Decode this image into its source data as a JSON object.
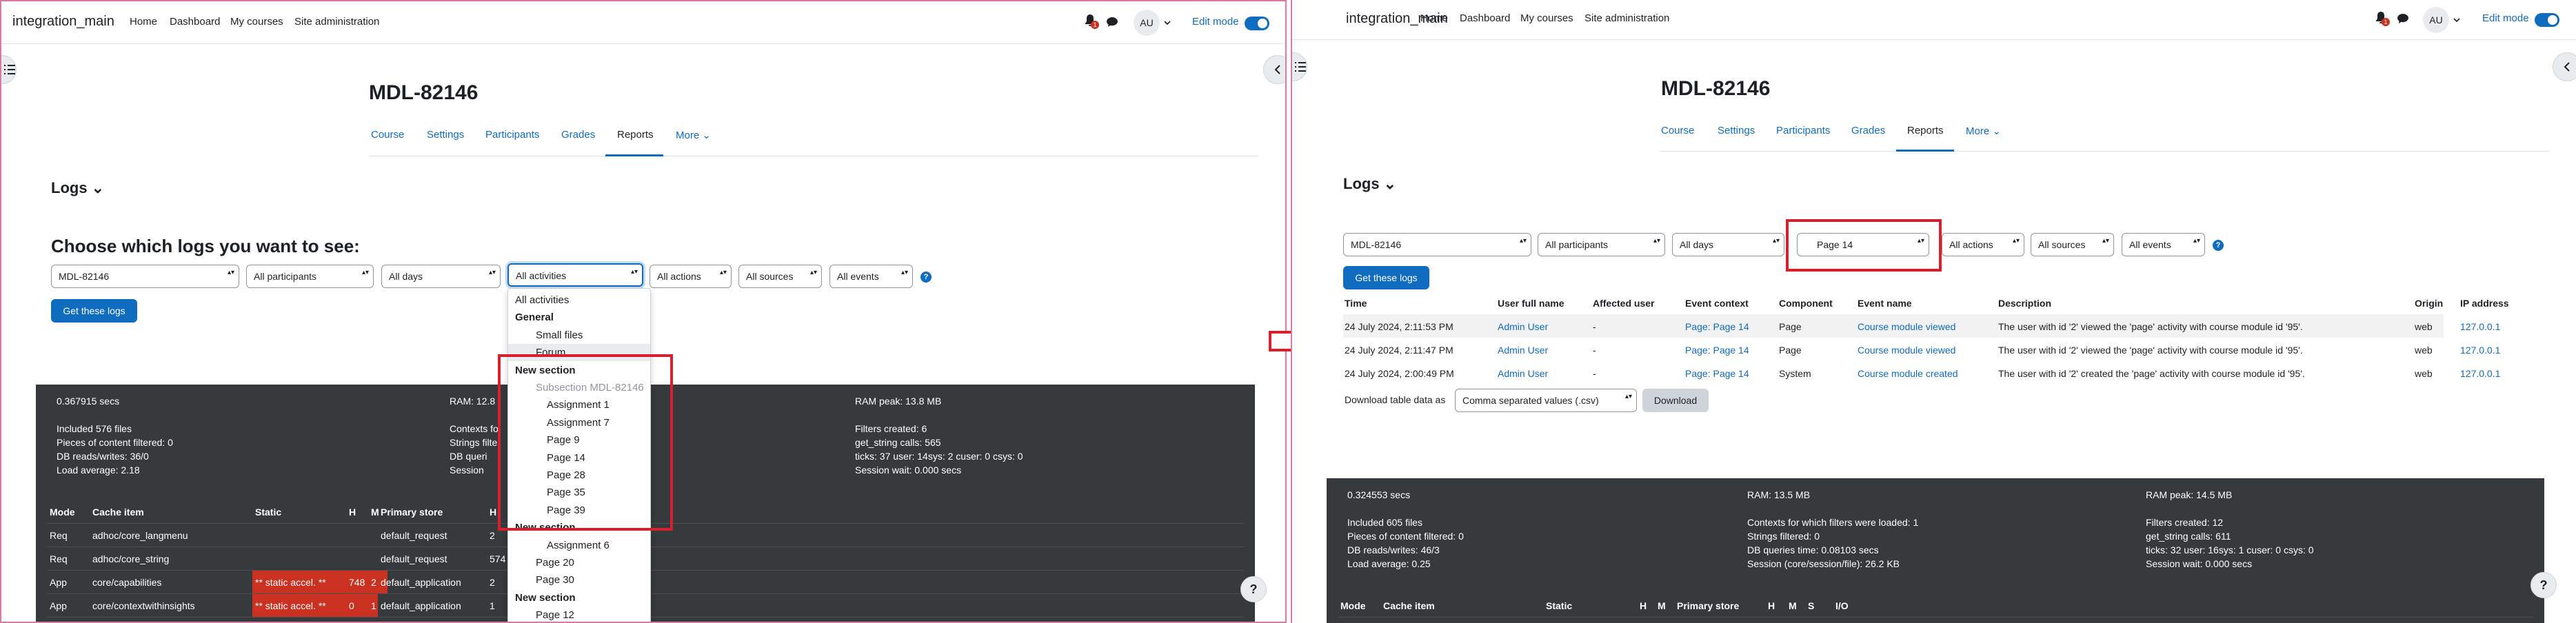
{
  "left": {
    "nav": {
      "brand": "integration_main",
      "links": [
        "Home",
        "Dashboard",
        "My courses",
        "Site administration"
      ],
      "notif_count": "1",
      "avatar": "AU",
      "edit_mode": "Edit mode"
    },
    "course_title": "MDL-82146",
    "tabs": [
      "Course",
      "Settings",
      "Participants",
      "Grades",
      "Reports",
      "More ⌄"
    ],
    "logs_heading": "Logs ⌄",
    "choose_heading": "Choose which logs you want to see:",
    "filters": {
      "course": "MDL-82146",
      "participants": "All participants",
      "days": "All days",
      "activities": "All activities",
      "actions": "All actions",
      "sources": "All sources",
      "events": "All events"
    },
    "get_logs": "Get these logs",
    "dropdown": [
      {
        "text": "All activities",
        "kind": "opt"
      },
      {
        "text": "General",
        "kind": "group"
      },
      {
        "text": "Small files",
        "kind": "opt1"
      },
      {
        "text": "Forum",
        "kind": "opt1sel"
      },
      {
        "text": "New section",
        "kind": "group"
      },
      {
        "text": "Subsection MDL-82146",
        "kind": "dis"
      },
      {
        "text": "Assignment 1",
        "kind": "opt2"
      },
      {
        "text": "Assignment 7",
        "kind": "opt2"
      },
      {
        "text": "Page 9",
        "kind": "opt2"
      },
      {
        "text": "Page 14",
        "kind": "opt2"
      },
      {
        "text": "Page 28",
        "kind": "opt2"
      },
      {
        "text": "Page 35",
        "kind": "opt2"
      },
      {
        "text": "Page 39",
        "kind": "opt2"
      },
      {
        "text": "New section",
        "kind": "group"
      },
      {
        "text": "Assignment 6",
        "kind": "opt2"
      },
      {
        "text": "Page 20",
        "kind": "opt1"
      },
      {
        "text": "Page 30",
        "kind": "opt1"
      },
      {
        "text": "New section",
        "kind": "group"
      },
      {
        "text": "Page 12",
        "kind": "opt1"
      }
    ],
    "perf": {
      "col1": [
        "0.367915 secs",
        "",
        "Included 576 files",
        "Pieces of content filtered: 0",
        "DB reads/writes: 36/0",
        "Load average: 2.18"
      ],
      "col2": [
        "RAM: 12.8",
        "",
        "Contexts fo",
        "Strings filte",
        "DB queri",
        "Session"
      ],
      "col3": [
        "RAM peak: 13.8 MB",
        "",
        "Filters created: 6",
        "get_string calls: 565",
        "ticks: 37 user: 14sys: 2 cuser: 0 csys: 0",
        "Session wait: 0.000 secs"
      ]
    },
    "cache_headers": [
      "Mode",
      "Cache item",
      "Static",
      "H",
      "M",
      "Primary store",
      "H",
      "M"
    ],
    "cache_rows": [
      [
        "Req",
        "adhoc/core_langmenu",
        "",
        "",
        "",
        "default_request",
        "2",
        ""
      ],
      [
        "Req",
        "adhoc/core_string",
        "",
        "",
        "",
        "default_request",
        "574",
        "5"
      ],
      [
        "App",
        "core/capabilities",
        "** static accel. **",
        "748",
        "2",
        "default_application",
        "2",
        ""
      ],
      [
        "App",
        "core/contextwithinsights",
        "** static accel. **",
        "0",
        "1",
        "default_application",
        "1",
        ""
      ]
    ]
  },
  "right": {
    "nav": {
      "brand": "integration_main",
      "links": [
        "Home",
        "Dashboard",
        "My courses",
        "Site administration"
      ],
      "notif_count": "1",
      "avatar": "AU",
      "edit_mode": "Edit mode"
    },
    "course_title": "MDL-82146",
    "tabs": [
      "Course",
      "Settings",
      "Participants",
      "Grades",
      "Reports",
      "More ⌄"
    ],
    "logs_heading": "Logs ⌄",
    "filters": {
      "course": "MDL-82146",
      "participants": "All participants",
      "days": "All days",
      "activities": "Page 14",
      "actions": "All actions",
      "sources": "All sources",
      "events": "All events"
    },
    "get_logs": "Get these logs",
    "log_headers": [
      "Time",
      "User full name",
      "Affected user",
      "Event context",
      "Component",
      "Event name",
      "Description",
      "Origin",
      "IP address"
    ],
    "log_rows": [
      [
        "24 July 2024, 2:11:53 PM",
        "Admin User",
        "-",
        "Page: Page 14",
        "Page",
        "Course module viewed",
        "The user with id '2' viewed the 'page' activity with course module id '95'.",
        "web",
        "127.0.0.1"
      ],
      [
        "24 July 2024, 2:11:47 PM",
        "Admin User",
        "-",
        "Page: Page 14",
        "Page",
        "Course module viewed",
        "The user with id '2' viewed the 'page' activity with course module id '95'.",
        "web",
        "127.0.0.1"
      ],
      [
        "24 July 2024, 2:00:49 PM",
        "Admin User",
        "-",
        "Page: Page 14",
        "System",
        "Course module created",
        "The user with id '2' created the 'page' activity with course module id '95'.",
        "web",
        "127.0.0.1"
      ]
    ],
    "download_label": "Download table data as",
    "download_format": "Comma separated values (.csv)",
    "download_button": "Download",
    "perf": {
      "col1": [
        "0.324553 secs",
        "",
        "Included 605 files",
        "Pieces of content filtered: 0",
        "DB reads/writes: 46/3",
        "Load average: 0.25"
      ],
      "col2": [
        "RAM: 13.5 MB",
        "",
        "Contexts for which filters were loaded: 1",
        "Strings filtered: 0",
        "DB queries time: 0.08103 secs",
        "Session (core/session/file): 26.2 KB"
      ],
      "col3": [
        "RAM peak: 14.5 MB",
        "",
        "Filters created: 12",
        "get_string calls: 611",
        "ticks: 32 user: 16sys: 1 cuser: 0 csys: 0",
        "Session wait: 0.000 secs"
      ]
    },
    "cache_headers": [
      "Mode",
      "Cache item",
      "Static",
      "H",
      "M",
      "Primary store",
      "H",
      "M",
      "S",
      "I/O"
    ]
  }
}
